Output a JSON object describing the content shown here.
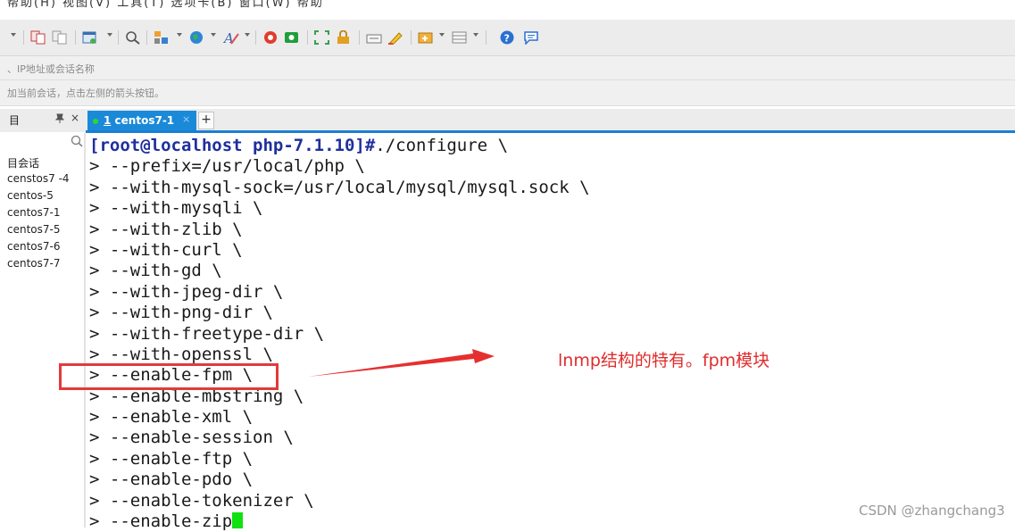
{
  "title_bar": {
    "text": "帮助(H) 视图(V) 工具(T) 选项卡(B) 窗口(W) 帮助"
  },
  "toolbar": {
    "icons": [
      "new-session-icon",
      "copy-icon",
      "paste-icon",
      "properties-icon",
      "find-icon",
      "sftp-icon",
      "globe-icon",
      "font-icon",
      "xagent-icon",
      "xftp-icon",
      "fullscreen-icon",
      "lock-icon",
      "keyboard-icon",
      "highlight-icon",
      "compose-icon",
      "layout-icon",
      "help-icon",
      "chat-icon"
    ]
  },
  "address_bar": {
    "placeholder": "、IP地址或会话名称"
  },
  "hint_bar": {
    "text": "加当前会话，点击左侧的箭头按钮。"
  },
  "left_pane": {
    "title": "目",
    "pin_glyph": "📌",
    "close_glyph": "×",
    "items": [
      "目会话",
      "censtos7 -4",
      "centos-5",
      "centos7-1",
      "centos7-5",
      "centos7-6",
      "centos7-7"
    ]
  },
  "tabs": [
    {
      "number": "1",
      "label": "centos7-1",
      "active": true
    }
  ],
  "terminal": {
    "prompt": "[root@localhost php-7.1.10]#",
    "command": "./configure \\",
    "lines": [
      "> --prefix=/usr/local/php \\",
      "> --with-mysql-sock=/usr/local/mysql/mysql.sock \\",
      "> --with-mysqli \\",
      "> --with-zlib \\",
      "> --with-curl \\",
      "> --with-gd \\",
      "> --with-jpeg-dir \\",
      "> --with-png-dir \\",
      "> --with-freetype-dir \\",
      "> --with-openssl \\",
      "> --enable-fpm \\",
      "> --enable-mbstring \\",
      "> --enable-xml \\",
      "> --enable-session \\",
      "> --enable-ftp \\",
      "> --enable-pdo \\",
      "> --enable-tokenizer \\"
    ],
    "last_line": "> --enable-zip"
  },
  "annotation": {
    "text": "lnmp结构的特有。fpm模块",
    "color": "#e02c2c"
  },
  "watermark": "CSDN @zhangchang3",
  "colors": {
    "tab_active": "#1a8ad8",
    "prompt": "#1f2f9e",
    "cursor": "#11e011",
    "highlight": "#e23a3a"
  }
}
